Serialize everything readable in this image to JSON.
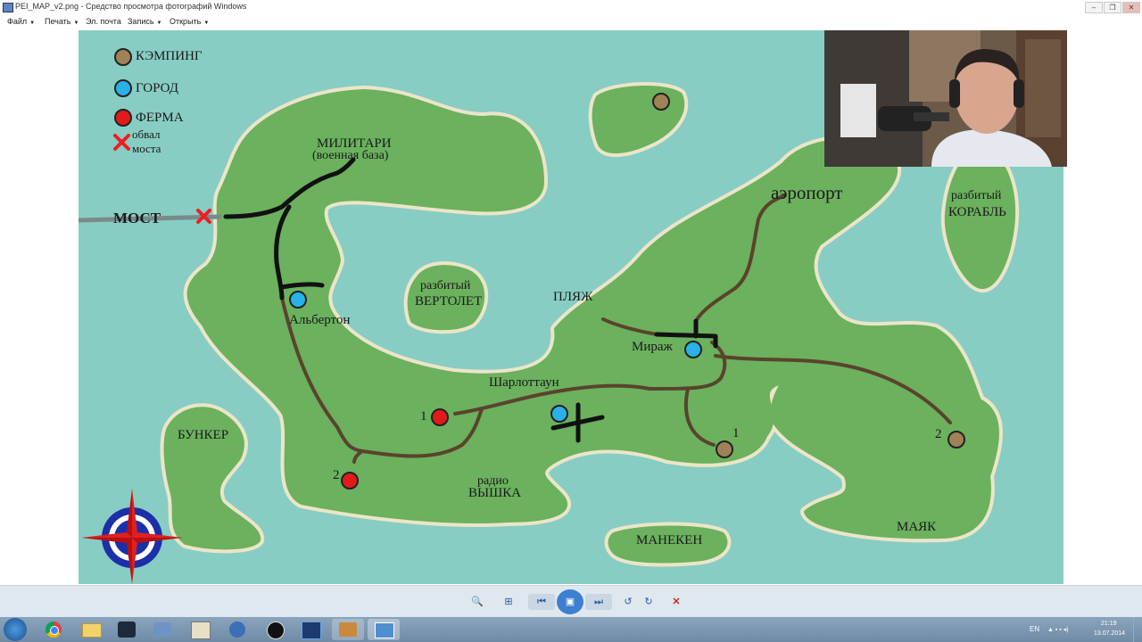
{
  "window": {
    "title": "PEI_MAP_v2.png - Средство просмотра фотографий Windows",
    "minimize_glyph": "–",
    "maximize_glyph": "❐",
    "close_glyph": "✕"
  },
  "menu": [
    {
      "label": "Файл"
    },
    {
      "label": "Печать"
    },
    {
      "label": "Эл. почта"
    },
    {
      "label": "Запись"
    },
    {
      "label": "Открыть"
    }
  ],
  "map": {
    "legend": {
      "camping": "КЭМПИНГ",
      "town": "ГОРОД",
      "farm": "ФЕРМА",
      "bridge_collapse_1": "обвал",
      "bridge_collapse_2": "моста"
    },
    "labels": {
      "military_1": "МИЛИТАРИ",
      "military_2": "(военная база)",
      "bridge": "МОСТ",
      "albertone": "Альбертон",
      "heli_1": "разбитый",
      "heli_2": "ВЕРТОЛЕТ",
      "beach": "ПЛЯЖ",
      "airport": "аэропорт",
      "ship_1": "разбитый",
      "ship_2": "КОРАБЛЬ",
      "mirage": "Мираж",
      "charlottetown": "Шарлоттаун",
      "farm1_num": "1",
      "farm2_num": "2",
      "camp1_num": "1",
      "camp2_num": "2",
      "bunker": "БУНКЕР",
      "radio_1": "радио",
      "radio_2": "ВЫШКА",
      "mannequin": "МАНЕКЕН",
      "lighthouse": "МАЯК"
    },
    "colors": {
      "water": "#87cdc3",
      "land": "#6bb15e",
      "shore": "#ece5c8",
      "camping": "#a08258",
      "town": "#2ab1e6",
      "farm": "#e31a1a",
      "road": "#5a432c",
      "main_road": "#111111",
      "bridge_x": "#ee1d24"
    }
  },
  "toolbar": {
    "zoom": "🔍",
    "fit": "⊞",
    "prev": "⏮",
    "slideshow": "▣",
    "next": "⏭",
    "rotate_left": "↺",
    "rotate_right": "↻",
    "delete": "✕"
  },
  "tray": {
    "lang": "EN",
    "time": "21:19",
    "date": "13.07.2014"
  }
}
